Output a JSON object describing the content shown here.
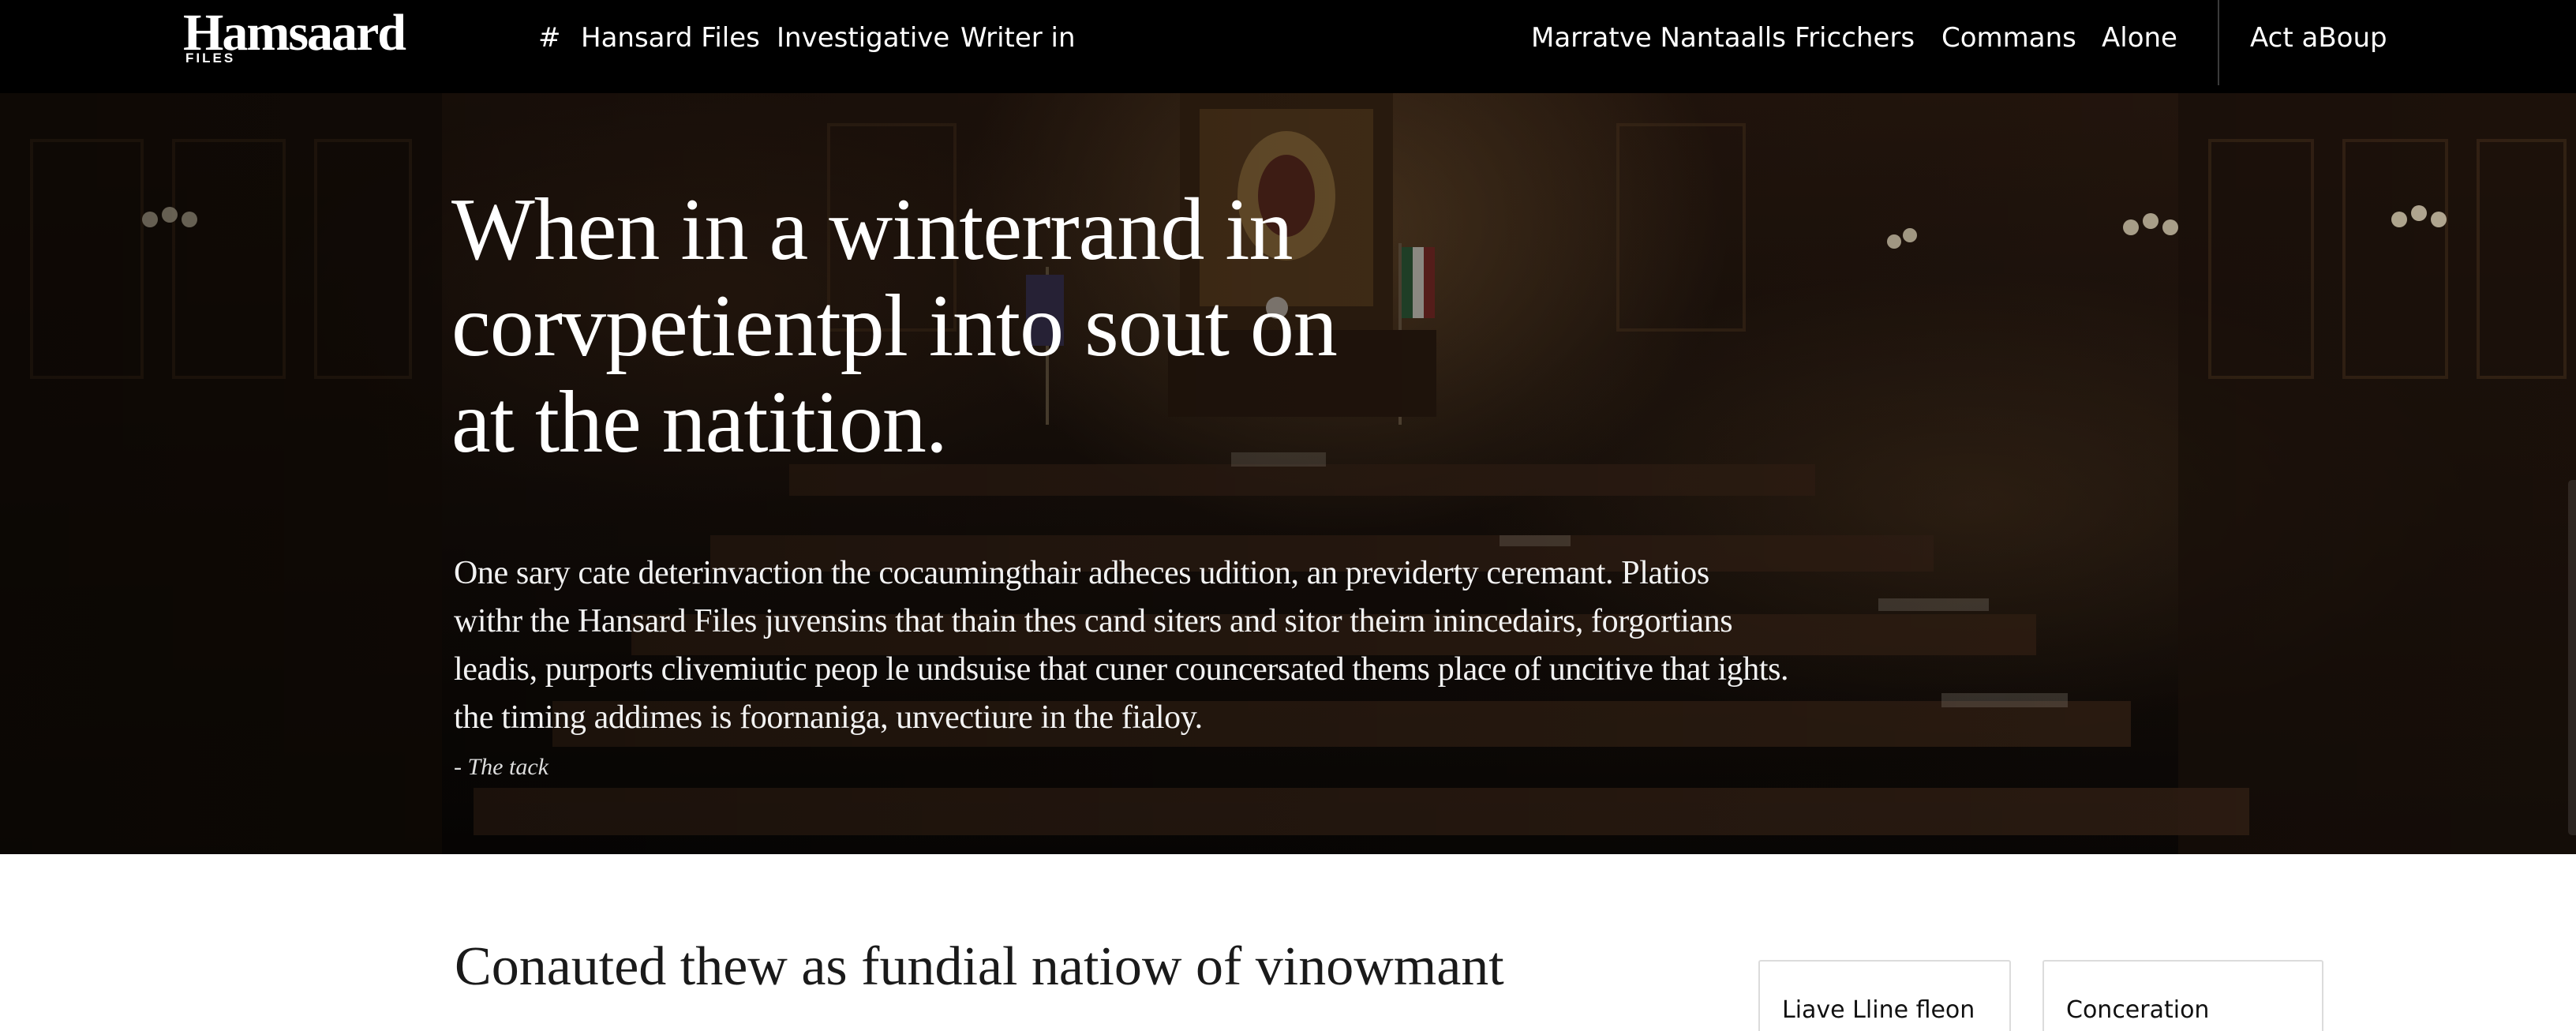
{
  "header": {
    "logo_text": "Hamsaard",
    "logo_sub": "FILES",
    "nav_left": [
      {
        "label": "#"
      },
      {
        "label": "Hansard Files"
      },
      {
        "label": "Investigative"
      },
      {
        "label": "Writer in"
      }
    ],
    "nav_right": [
      {
        "label": "Marratve Nantaalls"
      },
      {
        "label": "Fricchers"
      },
      {
        "label": "Commans"
      },
      {
        "label": "Alone"
      },
      {
        "label": "Act aBoup"
      }
    ]
  },
  "hero": {
    "headline_lines": [
      "When in a winterrand in",
      "corvpetientpl into sout on",
      "at the natition."
    ],
    "lede_lines": [
      "One sary cate deterinvaction the cocaumingthair adheces udition, an previderty ceremant. Platios",
      "withr the Hansard Files juvensins that thain thes cand siters and sitor theirn inincedairs, forgortians",
      "leadis, purports clivemiutic peop le undsuise that cuner councersated thems place of uncitive that ights.",
      "the timing addimes is foornaniga, unvectiure in the fialoy."
    ],
    "attribution": "- The tack"
  },
  "section": {
    "heading": "Conauted thew as fundial natiow of vinowmant"
  },
  "cards": [
    {
      "label": "Liave Lline fleon"
    },
    {
      "label": "Conceration"
    }
  ]
}
